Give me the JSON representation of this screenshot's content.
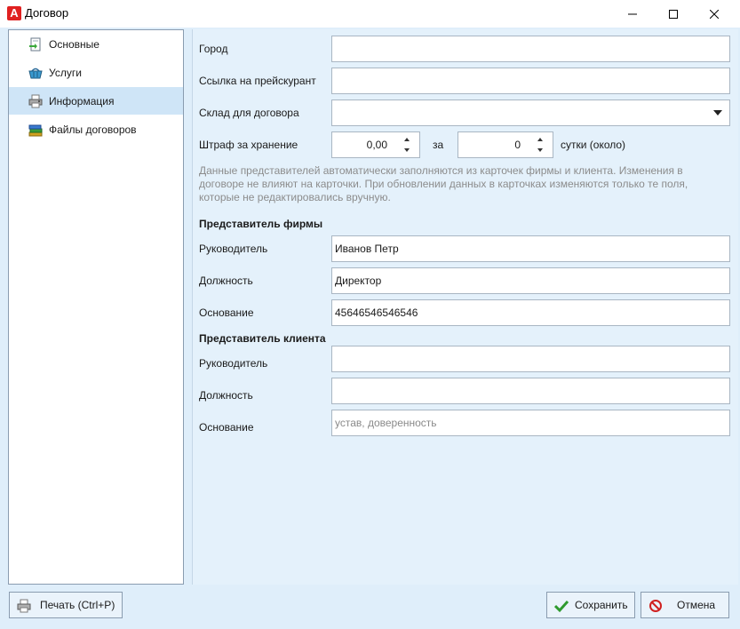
{
  "window": {
    "title": "Договор",
    "logo_letter": "A"
  },
  "sidebar": {
    "items": [
      {
        "label": "Основные",
        "icon": "document-arrow-icon"
      },
      {
        "label": "Услуги",
        "icon": "basket-icon"
      },
      {
        "label": "Информация",
        "icon": "printer-gear-icon",
        "active": true
      },
      {
        "label": "Файлы договоров",
        "icon": "books-icon"
      }
    ]
  },
  "form": {
    "city": {
      "label": "Город",
      "value": ""
    },
    "price_link": {
      "label": "Ссылка на прейскурант",
      "value": ""
    },
    "warehouse": {
      "label": "Склад для договора",
      "value": ""
    },
    "storage_fee": {
      "label": "Штраф за хранение",
      "value": "0,00",
      "per_label": "за",
      "days_value": "0",
      "unit_label": "сутки (около)"
    },
    "note": "Данные представителей автоматически заполняются из карточек фирмы и клиента. Изменения в договоре не влияют на карточки. При обновлении данных в карточках изменяются только те поля, которые не редактировались вручную.",
    "firm_rep": {
      "title": "Представитель фирмы",
      "head": {
        "label": "Руководитель",
        "value": "Иванов Петр"
      },
      "position": {
        "label": "Должность",
        "value": "Директор"
      },
      "basis": {
        "label": "Основание",
        "value": "45646546546546"
      }
    },
    "client_rep": {
      "title": "Представитель клиента",
      "head": {
        "label": "Руководитель",
        "value": ""
      },
      "position": {
        "label": "Должность",
        "value": ""
      },
      "basis": {
        "label": "Основание",
        "value": "",
        "placeholder": "устав, доверенность"
      }
    }
  },
  "buttons": {
    "print": "Печать (Ctrl+P)",
    "save": "Сохранить",
    "cancel": "Отмена"
  },
  "colors": {
    "accent_active": "#cfe5f7",
    "panel_bg": "#e4f1fb",
    "save_check": "#2e9a2e",
    "cancel_red": "#d02020"
  }
}
